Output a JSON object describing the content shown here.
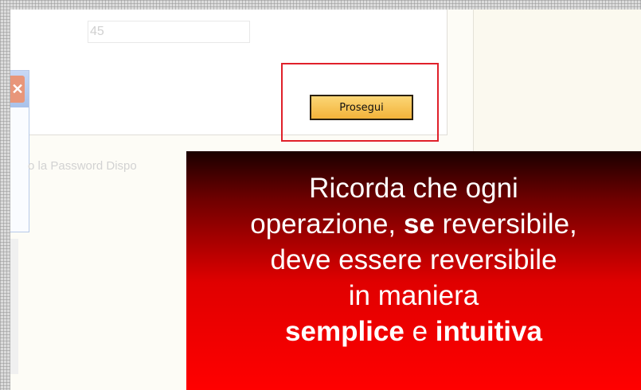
{
  "form": {
    "input_value": "45",
    "continue_button": "Prosegui"
  },
  "background": {
    "faded_text": "o la Password Dispo"
  },
  "popup": {
    "close_glyph": "✕"
  },
  "callout": {
    "line1": "Ricorda che ogni",
    "line2_a": "operazione, ",
    "line2_bold": "se",
    "line2_b": " reversibile,",
    "line3": "deve essere reversibile",
    "line4": "in maniera",
    "line5_bold1": "semplice",
    "line5_mid": " e ",
    "line5_bold2": "intuitiva"
  },
  "colors": {
    "highlight_border": "#e0202a",
    "button_fill": "#f3b33a",
    "callout_top": "#1a0000",
    "callout_bottom": "#ff0000"
  }
}
